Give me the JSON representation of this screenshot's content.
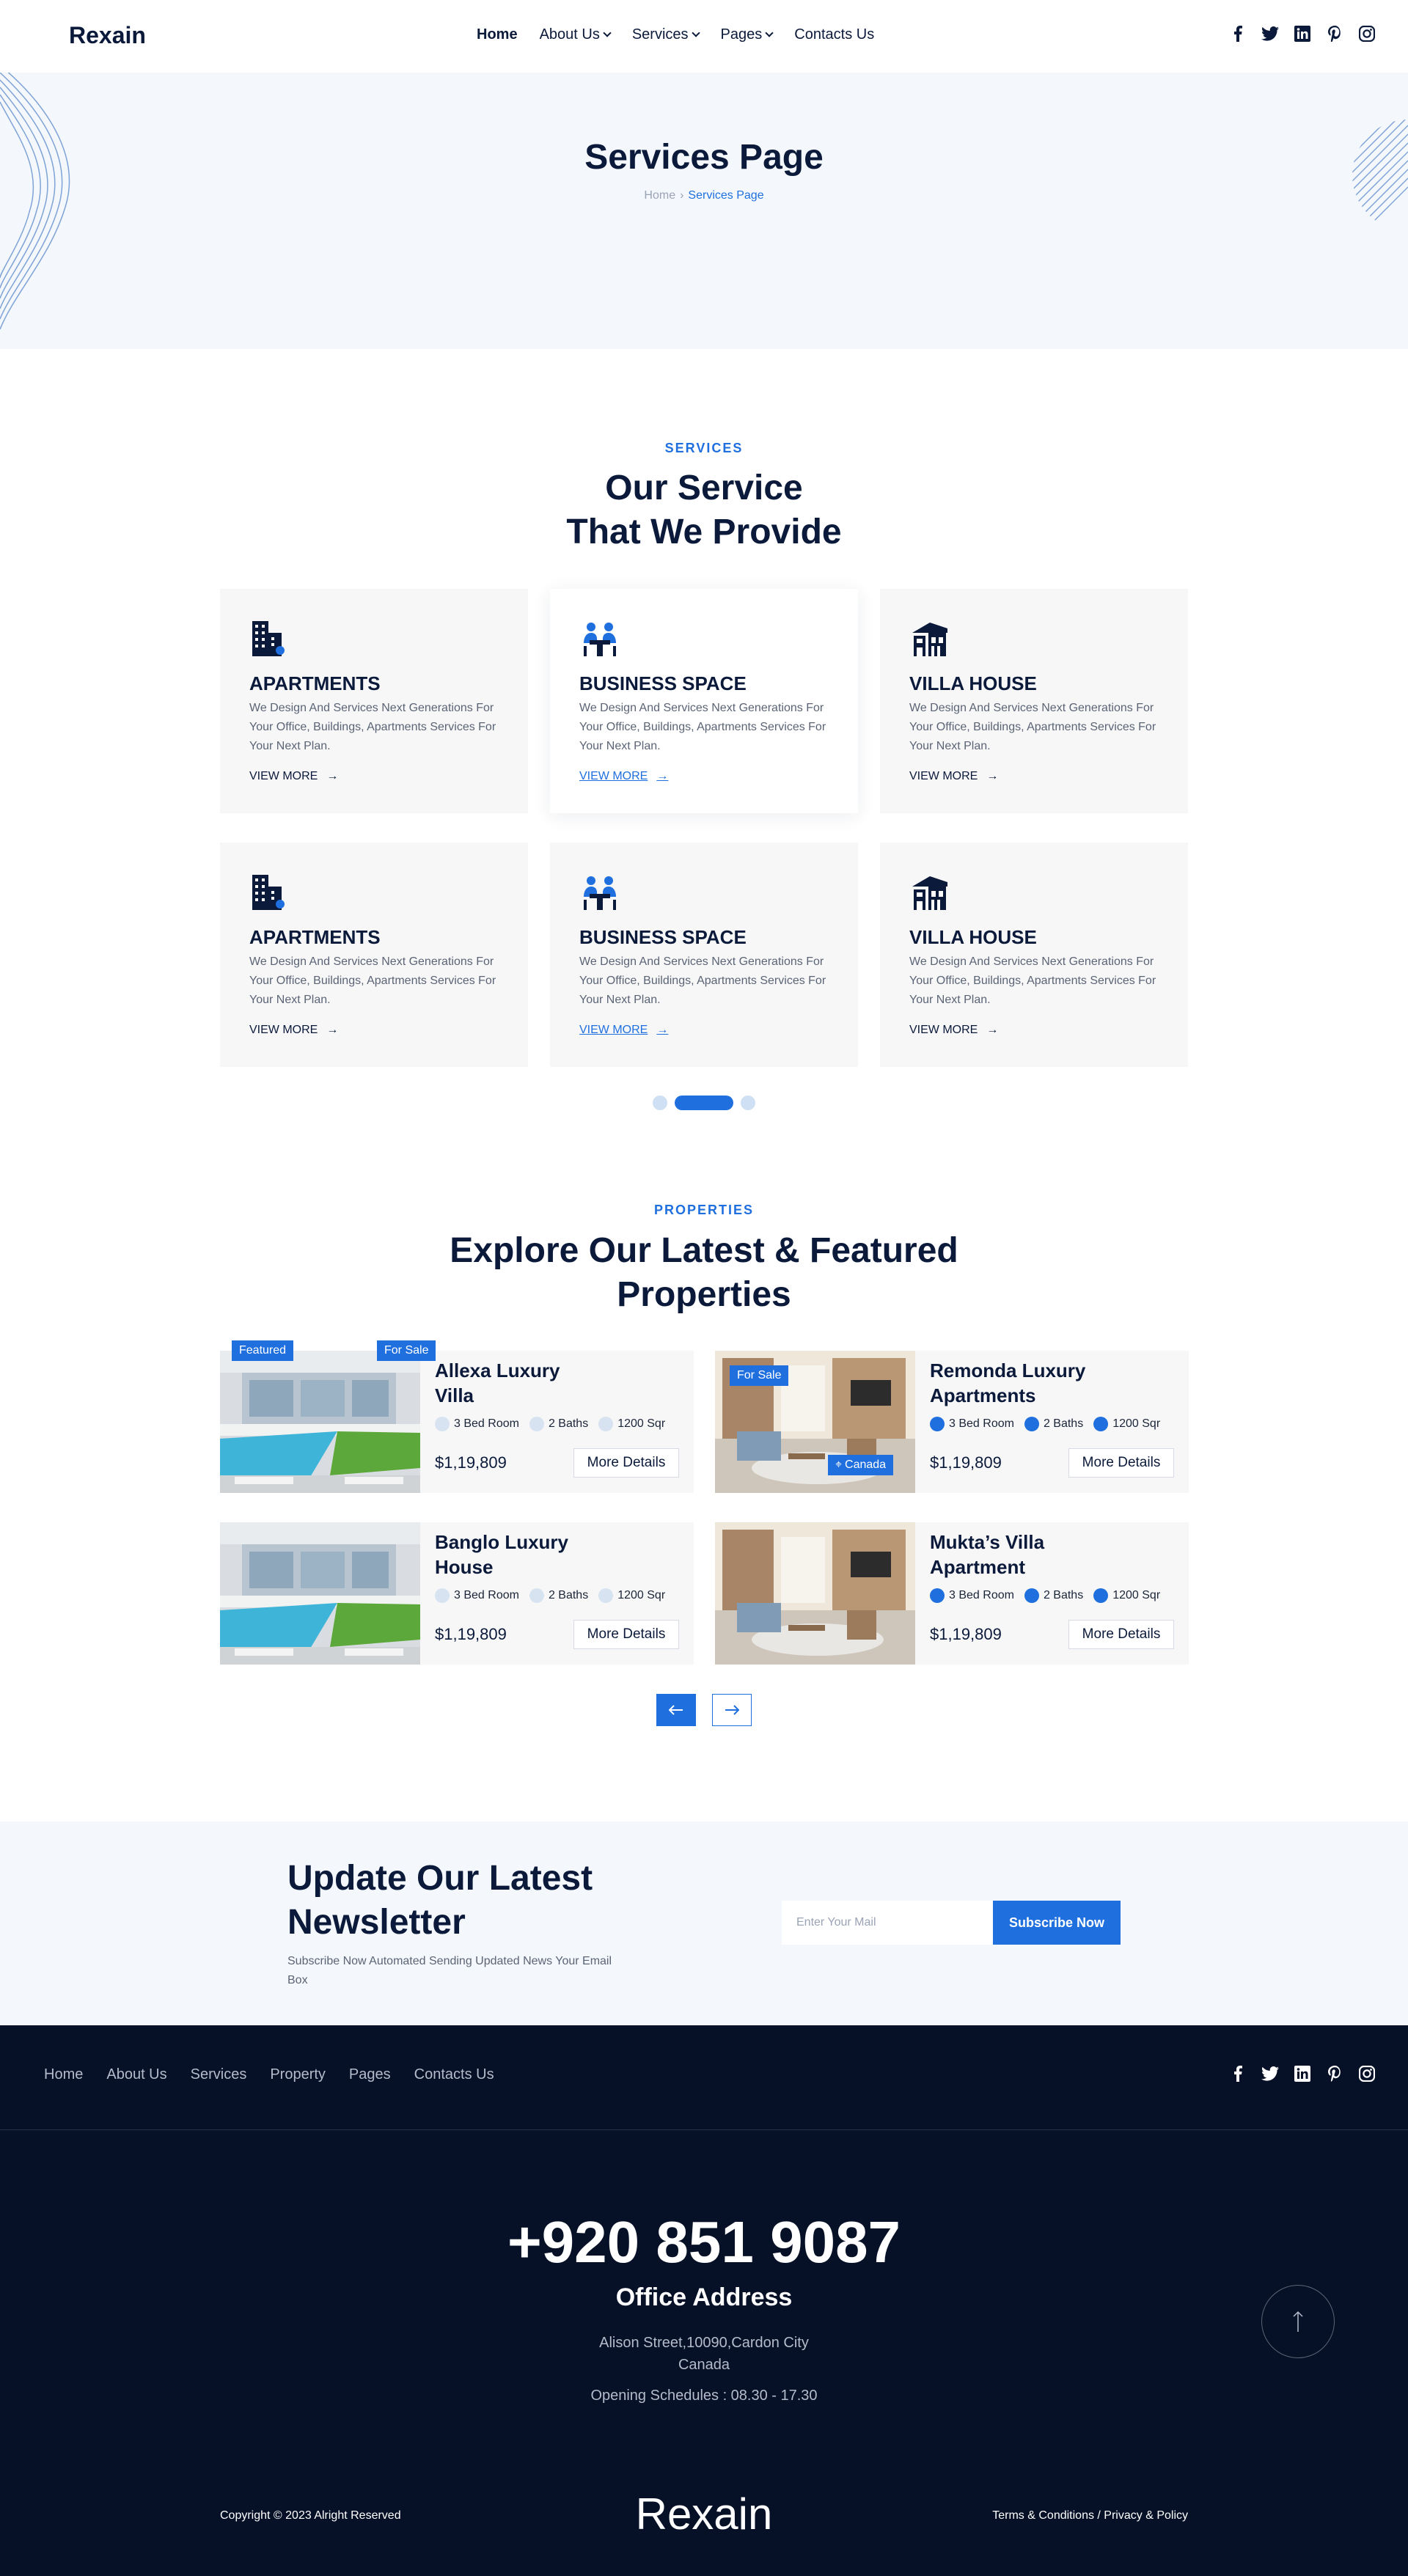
{
  "header": {
    "logo": "Rexain",
    "nav": [
      {
        "label": "Home"
      },
      {
        "label": "About Us"
      },
      {
        "label": "Services"
      },
      {
        "label": "Pages"
      },
      {
        "label": "Contacts Us"
      }
    ],
    "social_icons": [
      "facebook-icon",
      "twitter-icon",
      "linkedin-icon",
      "pinterest-icon",
      "instagram-icon"
    ]
  },
  "hero": {
    "title": "Services Page",
    "breadcrumb_home": "Home",
    "breadcrumb_current": "Services Page"
  },
  "services": {
    "tag": "SERVICES",
    "title_line1": "Our Service",
    "title_line2": "That We Provide",
    "cards": [
      {
        "title": "APARTMENTS",
        "desc": "We Design And Services Next Generations For Your Office, Buildings, Apartments Services For Your Next Plan.",
        "more": "VIEW MORE",
        "icon": "building-icon"
      },
      {
        "title": "BUSINESS SPACE",
        "desc": "We Design And Services Next Generations For Your Office, Buildings, Apartments Services For Your Next Plan.",
        "more": "VIEW MORE",
        "icon": "meeting-icon"
      },
      {
        "title": "VILLA HOUSE",
        "desc": "We Design And Services Next Generations For Your Office, Buildings, Apartments Services For Your Next Plan.",
        "more": "VIEW MORE",
        "icon": "villa-icon"
      },
      {
        "title": "APARTMENTS",
        "desc": "We Design And Services Next Generations For Your Office, Buildings, Apartments Services For Your Next Plan.",
        "more": "VIEW MORE",
        "icon": "building-icon"
      },
      {
        "title": "BUSINESS SPACE",
        "desc": "We Design And Services Next Generations For Your Office, Buildings, Apartments Services For Your Next Plan.",
        "more": "VIEW MORE",
        "icon": "meeting-icon"
      },
      {
        "title": "VILLA HOUSE",
        "desc": "We Design And Services Next Generations For Your Office, Buildings, Apartments Services For Your Next Plan.",
        "more": "VIEW MORE",
        "icon": "villa-icon"
      }
    ]
  },
  "properties": {
    "tag": "PROPERTIES",
    "title_line1": "Explore Our Latest & Featured",
    "title_line2": "Properties",
    "items": [
      {
        "name_line1": "Allexa Luxury",
        "name_line2": "Villa",
        "beds": "3 Bed Room",
        "baths": "2 Baths",
        "area": "1200 Sqr",
        "price": "$1,19,809",
        "button": "More Details",
        "badge_left": "Featured",
        "badge_right": "For Sale"
      },
      {
        "name_line1": "Remonda Luxury",
        "name_line2": "Apartments",
        "beds": "3 Bed Room",
        "baths": "2 Baths",
        "area": "1200 Sqr",
        "price": "$1,19,809",
        "button": "More Details",
        "badge": "For Sale",
        "location": "Canada"
      },
      {
        "name_line1": "Banglo Luxury",
        "name_line2": "House",
        "beds": "3 Bed Room",
        "baths": "2 Baths",
        "area": "1200 Sqr",
        "price": "$1,19,809",
        "button": "More Details"
      },
      {
        "name_line1": "Mukta’s Villa",
        "name_line2": "Apartment",
        "beds": "3 Bed Room",
        "baths": "2 Baths",
        "area": "1200 Sqr",
        "price": "$1,19,809",
        "button": "More Details"
      }
    ]
  },
  "newsletter": {
    "title_line1": "Update Our Latest",
    "title_line2": "Newsletter",
    "subtitle": "Subscribe Now Automated Sending Updated News Your Email Box",
    "placeholder": "Enter Your Mail",
    "button": "Subscribe Now"
  },
  "footer": {
    "nav": [
      "Home",
      "About Us",
      "Services",
      "Property",
      "Pages",
      "Contacts Us"
    ],
    "phone": "+920 851 9087",
    "office_title": "Office Address",
    "address_line1": "Alison Street,10090,Cardon City",
    "address_line2": "Canada",
    "schedule": "Opening Schedules : 08.30 - 17.30",
    "copyright": "Copyright © 2023 Alright Reserved",
    "logo": "Rexain",
    "terms": "Terms & Conditions / Privacy & Policy"
  },
  "colors": {
    "accent": "#1f6fde",
    "navy": "#0b1a3a",
    "footer_bg": "#061127",
    "hero_bg": "#f4f8fc"
  }
}
